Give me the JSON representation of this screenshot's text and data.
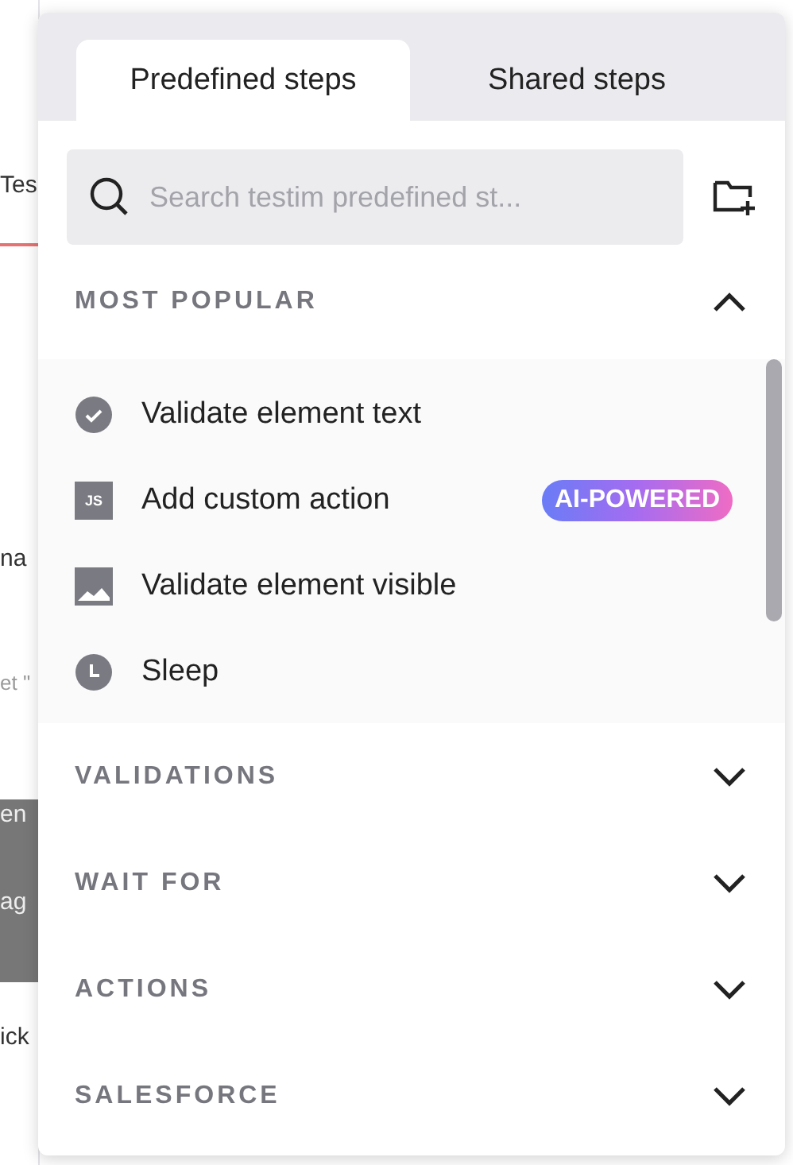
{
  "background": {
    "fragments": [
      {
        "text": "Tes",
        "kind": "plain"
      },
      {
        "text": "na",
        "kind": "plain"
      },
      {
        "text": "et \"",
        "kind": "muted"
      },
      {
        "text": "en",
        "kind": "dark"
      },
      {
        "text": "ag",
        "kind": "dark"
      },
      {
        "text": "ick",
        "kind": "plain"
      }
    ]
  },
  "tabs": [
    {
      "label": "Predefined steps",
      "selected": true
    },
    {
      "label": "Shared steps",
      "selected": false
    }
  ],
  "search": {
    "placeholder": "Search testim predefined st..."
  },
  "sections": [
    {
      "title": "MOST POPULAR",
      "expanded": true,
      "items": [
        {
          "label": "Validate element text",
          "kind": "check"
        },
        {
          "label": "Add custom action",
          "kind": "js",
          "icon_label": "JS",
          "badge": "AI-POWERED"
        },
        {
          "label": "Validate element visible",
          "kind": "image"
        },
        {
          "label": "Sleep",
          "kind": "clock"
        }
      ]
    },
    {
      "title": "VALIDATIONS",
      "expanded": false
    },
    {
      "title": "WAIT FOR",
      "expanded": false
    },
    {
      "title": "ACTIONS",
      "expanded": false
    },
    {
      "title": "SALESFORCE",
      "expanded": false
    }
  ]
}
